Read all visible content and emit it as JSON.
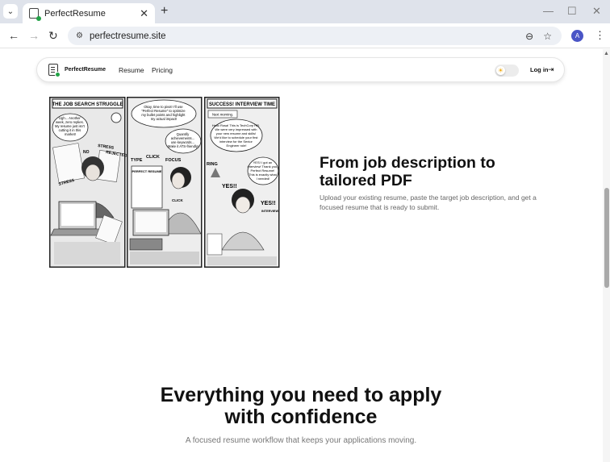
{
  "browser": {
    "tab_title": "PerfectResume",
    "tab_close": "✕",
    "new_tab": "+",
    "url": "perfectresume.site",
    "profile_initial": "A"
  },
  "site": {
    "brand": "PerfectResume",
    "nav": [
      "Resume",
      "Pricing"
    ],
    "login": "Log in"
  },
  "comic": {
    "panels": [
      {
        "title": "THE JOB SEARCH STRUGGLE",
        "bubble": [
          "Ugh... Another",
          "week, zero replies.",
          "My resume just isn't",
          "cutting it in this",
          "market!"
        ],
        "words": [
          "STRESS",
          "REJECTED",
          "STRESS",
          "NO"
        ]
      },
      {
        "bubble": [
          "Okay, time to pivot! I'll use",
          "\"Perfect Resume\" to optimize",
          "my bullet points and highlight",
          "my actual impact!"
        ],
        "bubble2": [
          "Quantify",
          "achievements...",
          "use keywords...",
          "Make it ATS-friendly!"
        ],
        "words": [
          "TYPE",
          "CLICK",
          "FOCUS",
          "CLICK"
        ],
        "doc": "PERFECT RESUME"
      },
      {
        "title": "SUCCESS! INTERVIEW TIME",
        "caption": "Next morning.",
        "bubble": [
          "Hello Rosa! This is TechCorp HR.",
          "We were very impressed with",
          "your new resume and skills!",
          "We'd like to schedule your first",
          "interview for the Senior",
          "Engineer role!"
        ],
        "bubble2": [
          "YES! I got an",
          "interview! Thank you,",
          "Perfect Resume!",
          "This is exactly what",
          "I needed!"
        ],
        "words": [
          "RING",
          "YES!!",
          "YES!!",
          "INTERVIEW"
        ]
      }
    ]
  },
  "hero": {
    "title_line1": "From job description to",
    "title_line2": "tailored PDF",
    "subtitle": "Upload your existing resume, paste the target job description, and get a focused resume that is ready to submit."
  },
  "features": {
    "title_line1": "Everything you need to apply",
    "title_line2": "with confidence",
    "subtitle": "A focused resume workflow that keeps your applications moving."
  },
  "colors": {
    "accent_green": "#22a347",
    "tab_strip": "#dfe3eb",
    "omnibox": "#edf0f5",
    "profile": "#4a55c6",
    "sun": "#f0a400"
  },
  "icons": {
    "tab_menu": "chevron-down-icon",
    "back": "arrow-left-icon",
    "forward": "arrow-right-icon",
    "reload": "reload-icon",
    "site_controls": "tune-icon",
    "zoom": "zoom-icon",
    "bookmark": "star-icon",
    "menu": "kebab-icon",
    "theme": "sun-icon",
    "login": "login-arrow-icon"
  }
}
